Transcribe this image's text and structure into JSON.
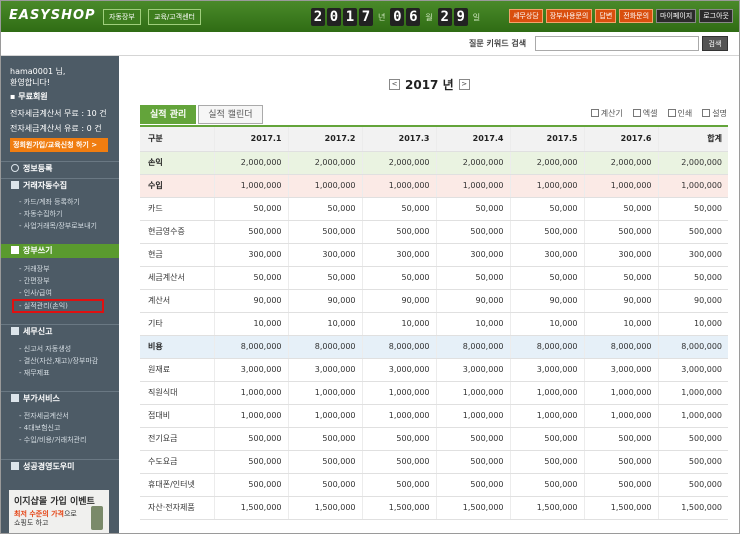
{
  "header": {
    "logo": "EASYSHOP",
    "nav": [
      "자동장부",
      "교육/고객센터"
    ],
    "date": {
      "year": "2017",
      "month": "06",
      "day": "29",
      "year_suffix": "년",
      "month_suffix": "월",
      "day_suffix": "일"
    },
    "links": [
      "세무상담",
      "장부사용문의",
      "답변",
      "전화문의",
      "마이페이지",
      "로그아웃"
    ]
  },
  "search": {
    "label": "질문 키워드 검색",
    "value": "",
    "button": "검색"
  },
  "sidebar": {
    "user_line1": "hama0001 님,",
    "user_line2": "환영합니다!",
    "member": "무료회원",
    "tax_invoice_free": "전자세금계산서 무료 : 10 건",
    "tax_invoice_paid": "전자세금계산서 유료 : 0 건",
    "signup_button": "정회원가입/교육신청 하기 >",
    "sections": [
      {
        "title": "정보등록",
        "items": []
      },
      {
        "title": "거래자동수집",
        "items": [
          "카드/계좌 등록하기",
          "자동수집하기",
          "사업거래목/장부로보내기"
        ]
      },
      {
        "title": "장부쓰기",
        "items": [
          "거래장부",
          "간편장부",
          "인사/급여",
          "실적관리(손익)"
        ]
      },
      {
        "title": "세무신고",
        "items": [
          "신고서 자동생성",
          "결산(자산,재고)/장부마감",
          "재무제표"
        ]
      },
      {
        "title": "부가서비스",
        "items": [
          "전자세금계산서",
          "4대보험신고",
          "수입/비용/거래처관리"
        ]
      },
      {
        "title": "성공경영도우미",
        "items": []
      }
    ],
    "promo": {
      "title": "이지샵몰 가입 이벤트",
      "line1_highlight": "최저 수준의 가격",
      "line1_rest": "으로",
      "line2": "쇼핑도 하고"
    }
  },
  "main": {
    "year_label": "2017 년",
    "prev_label": "<",
    "next_label": ">",
    "tabs": [
      "실적 관리",
      "실적 캘린더"
    ],
    "tools": [
      "계산기",
      "엑셀",
      "인쇄",
      "설명"
    ],
    "table": {
      "headers": [
        "구분",
        "2017.1",
        "2017.2",
        "2017.3",
        "2017.4",
        "2017.5",
        "2017.6",
        "합계"
      ],
      "rows": [
        {
          "type": "rev",
          "cells": [
            "손익",
            "2,000,000",
            "2,000,000",
            "2,000,000",
            "2,000,000",
            "2,000,000",
            "2,000,000",
            "2,000,000"
          ]
        },
        {
          "type": "income",
          "cells": [
            "수입",
            "1,000,000",
            "1,000,000",
            "1,000,000",
            "1,000,000",
            "1,000,000",
            "1,000,000",
            "1,000,000"
          ]
        },
        {
          "type": "",
          "cells": [
            "카드",
            "50,000",
            "50,000",
            "50,000",
            "50,000",
            "50,000",
            "50,000",
            "50,000"
          ]
        },
        {
          "type": "",
          "cells": [
            "현금영수증",
            "500,000",
            "500,000",
            "500,000",
            "500,000",
            "500,000",
            "500,000",
            "500,000"
          ]
        },
        {
          "type": "",
          "cells": [
            "현금",
            "300,000",
            "300,000",
            "300,000",
            "300,000",
            "300,000",
            "300,000",
            "300,000"
          ]
        },
        {
          "type": "",
          "cells": [
            "세금계산서",
            "50,000",
            "50,000",
            "50,000",
            "50,000",
            "50,000",
            "50,000",
            "50,000"
          ]
        },
        {
          "type": "",
          "cells": [
            "계산서",
            "90,000",
            "90,000",
            "90,000",
            "90,000",
            "90,000",
            "90,000",
            "90,000"
          ]
        },
        {
          "type": "",
          "cells": [
            "기타",
            "10,000",
            "10,000",
            "10,000",
            "10,000",
            "10,000",
            "10,000",
            "10,000"
          ]
        },
        {
          "type": "cost",
          "cells": [
            "비용",
            "8,000,000",
            "8,000,000",
            "8,000,000",
            "8,000,000",
            "8,000,000",
            "8,000,000",
            "8,000,000"
          ]
        },
        {
          "type": "",
          "cells": [
            "원재료",
            "3,000,000",
            "3,000,000",
            "3,000,000",
            "3,000,000",
            "3,000,000",
            "3,000,000",
            "3,000,000"
          ]
        },
        {
          "type": "",
          "cells": [
            "직원식대",
            "1,000,000",
            "1,000,000",
            "1,000,000",
            "1,000,000",
            "1,000,000",
            "1,000,000",
            "1,000,000"
          ]
        },
        {
          "type": "",
          "cells": [
            "접대비",
            "1,000,000",
            "1,000,000",
            "1,000,000",
            "1,000,000",
            "1,000,000",
            "1,000,000",
            "1,000,000"
          ]
        },
        {
          "type": "",
          "cells": [
            "전기요금",
            "500,000",
            "500,000",
            "500,000",
            "500,000",
            "500,000",
            "500,000",
            "500,000"
          ]
        },
        {
          "type": "",
          "cells": [
            "수도요금",
            "500,000",
            "500,000",
            "500,000",
            "500,000",
            "500,000",
            "500,000",
            "500,000"
          ]
        },
        {
          "type": "",
          "cells": [
            "휴대폰/인터넷",
            "500,000",
            "500,000",
            "500,000",
            "500,000",
            "500,000",
            "500,000",
            "500,000"
          ]
        },
        {
          "type": "",
          "cells": [
            "자산·전자제품",
            "1,500,000",
            "1,500,000",
            "1,500,000",
            "1,500,000",
            "1,500,000",
            "1,500,000",
            "1,500,000"
          ]
        }
      ]
    }
  },
  "colors": {
    "brand_green": "#63a43a",
    "accent_orange": "#f07d10",
    "sidebar_bg": "#4d5b66",
    "highlight_red": "#e01010"
  }
}
